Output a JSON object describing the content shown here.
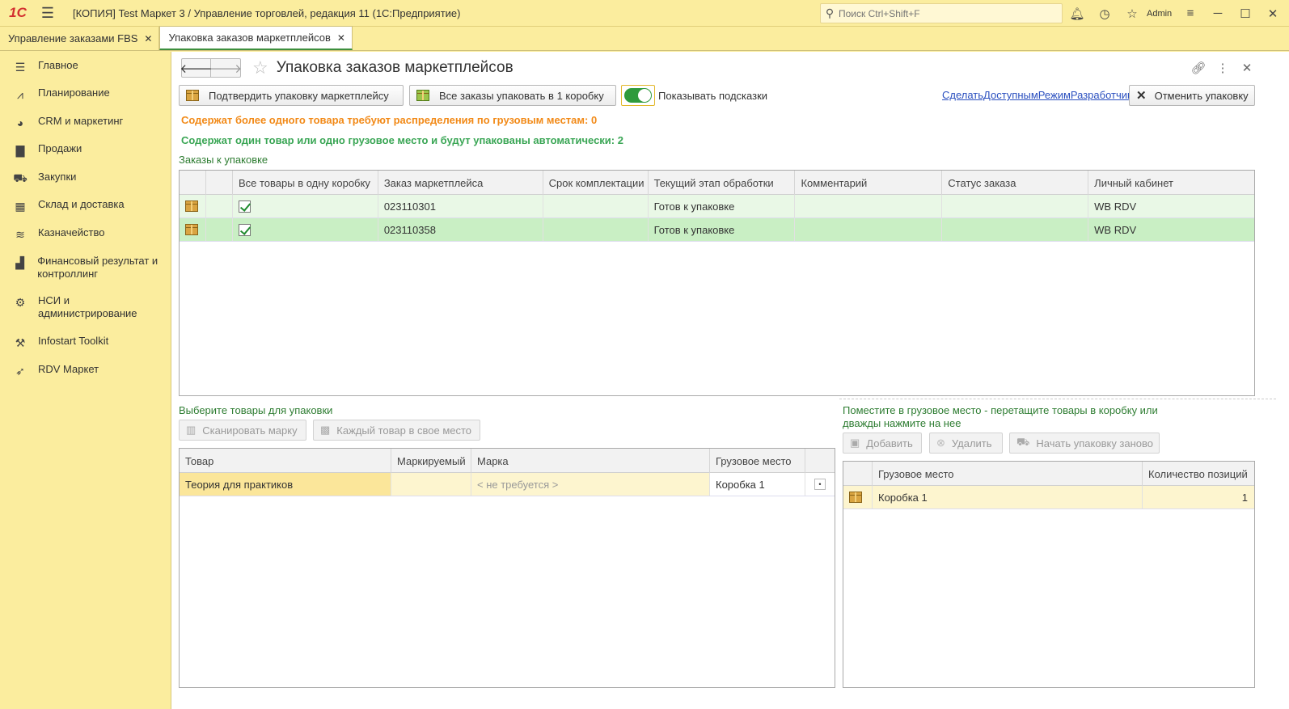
{
  "app": {
    "logo_text": "1С",
    "window_title": "[КОПИЯ] Test Маркет 3 / Управление торговлей, редакция 11  (1С:Предприятие)",
    "search_placeholder": "Поиск Ctrl+Shift+F",
    "user": "Admin"
  },
  "tabs": [
    {
      "label": "Управление заказами FBS",
      "active": false
    },
    {
      "label": "Упаковка заказов маркетплейсов",
      "active": true
    }
  ],
  "sidebar": {
    "items": [
      {
        "label": "Главное",
        "icon": "list-icon"
      },
      {
        "label": "Планирование",
        "icon": "chart-line-icon"
      },
      {
        "label": "CRM и маркетинг",
        "icon": "pie-chart-icon"
      },
      {
        "label": "Продажи",
        "icon": "shopping-bag-icon"
      },
      {
        "label": "Закупки",
        "icon": "cart-icon"
      },
      {
        "label": "Склад и доставка",
        "icon": "grid-icon"
      },
      {
        "label": "Казначейство",
        "icon": "coins-icon"
      },
      {
        "label": "Финансовый результат и контроллинг",
        "icon": "bar-chart-icon"
      },
      {
        "label": "НСИ и администрирование",
        "icon": "gear-icon"
      },
      {
        "label": "Infostart Toolkit",
        "icon": "tools-icon"
      },
      {
        "label": "RDV Маркет",
        "icon": "rocket-icon"
      }
    ]
  },
  "form": {
    "title": "Упаковка заказов маркетплейсов",
    "buttons": {
      "confirm": "Подтвердить упаковку маркетплейсу",
      "all_in_one": "Все заказы упаковать в 1 коробку",
      "cancel": "Отменить упаковку"
    },
    "toggle_label": "Показывать подсказки",
    "toggle_on": true,
    "dev_link": "СделатьДоступнымРежимРазработчика",
    "info_multi": "Содержат более одного товара требуют распределения по грузовым местам: 0",
    "info_single": "Содержат один товар или одно грузовое место и будут упакованы автоматически: 2",
    "orders_group": "Заказы к упаковке"
  },
  "orders_table": {
    "columns": [
      "",
      "",
      "Все товары в одну коробку",
      "Заказ маркетплейса",
      "Срок комплектации",
      "Текущий этап обработки",
      "Комментарий",
      "Статус заказа",
      "Личный кабинет"
    ],
    "rows": [
      {
        "all_in_one": true,
        "order": "023110301",
        "deadline": "",
        "stage": "Готов к упаковке",
        "comment": "",
        "status": "",
        "cabinet": "WB RDV"
      },
      {
        "all_in_one": true,
        "order": "023110358",
        "deadline": "",
        "stage": "Готов к упаковке",
        "comment": "",
        "status": "",
        "cabinet": "WB RDV"
      }
    ]
  },
  "goods": {
    "group": "Выберите товары для упаковки",
    "btn_scan": "Сканировать марку",
    "btn_each": "Каждый товар в свое место",
    "columns": [
      "Товар",
      "Маркируемый",
      "Марка",
      "Грузовое место",
      ""
    ],
    "rows": [
      {
        "product": "Теория для практиков",
        "marked": "",
        "mark": "< не требуется >",
        "place": "Коробка 1",
        "dot": "•"
      }
    ]
  },
  "places": {
    "group_line1": "Поместите в грузовое место - перетащите товары в коробку или",
    "group_line2": "дважды нажмите на нее",
    "btn_add": "Добавить",
    "btn_delete": "Удалить",
    "btn_restart": "Начать упаковку заново",
    "columns": [
      "",
      "Грузовое место",
      "Количество позиций"
    ],
    "rows": [
      {
        "place": "Коробка 1",
        "count": "1"
      }
    ]
  }
}
